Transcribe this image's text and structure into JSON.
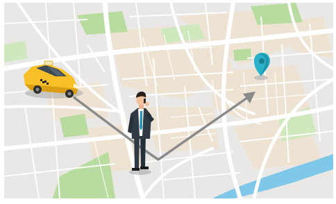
{
  "scene": {
    "type": "illustration",
    "subject": "taxi-ride-booking-map",
    "colors": {
      "map_background": "#e9e8e6",
      "block_tint": "#efe3d2",
      "park": "#b8dca0",
      "park_light": "#cfe8bd",
      "river": "#7fc8ea",
      "road": "#ffffff",
      "route_arrow": "#8a8a8a",
      "taxi_body": "#f6c026",
      "taxi_shadow": "#d99e12",
      "pin": "#2bb1c9",
      "suit": "#2f3a45",
      "tie": "#2a93b8"
    },
    "icons": [
      "taxi-icon",
      "location-pin-icon",
      "person-on-phone-figure",
      "route-arrow-icon"
    ]
  }
}
